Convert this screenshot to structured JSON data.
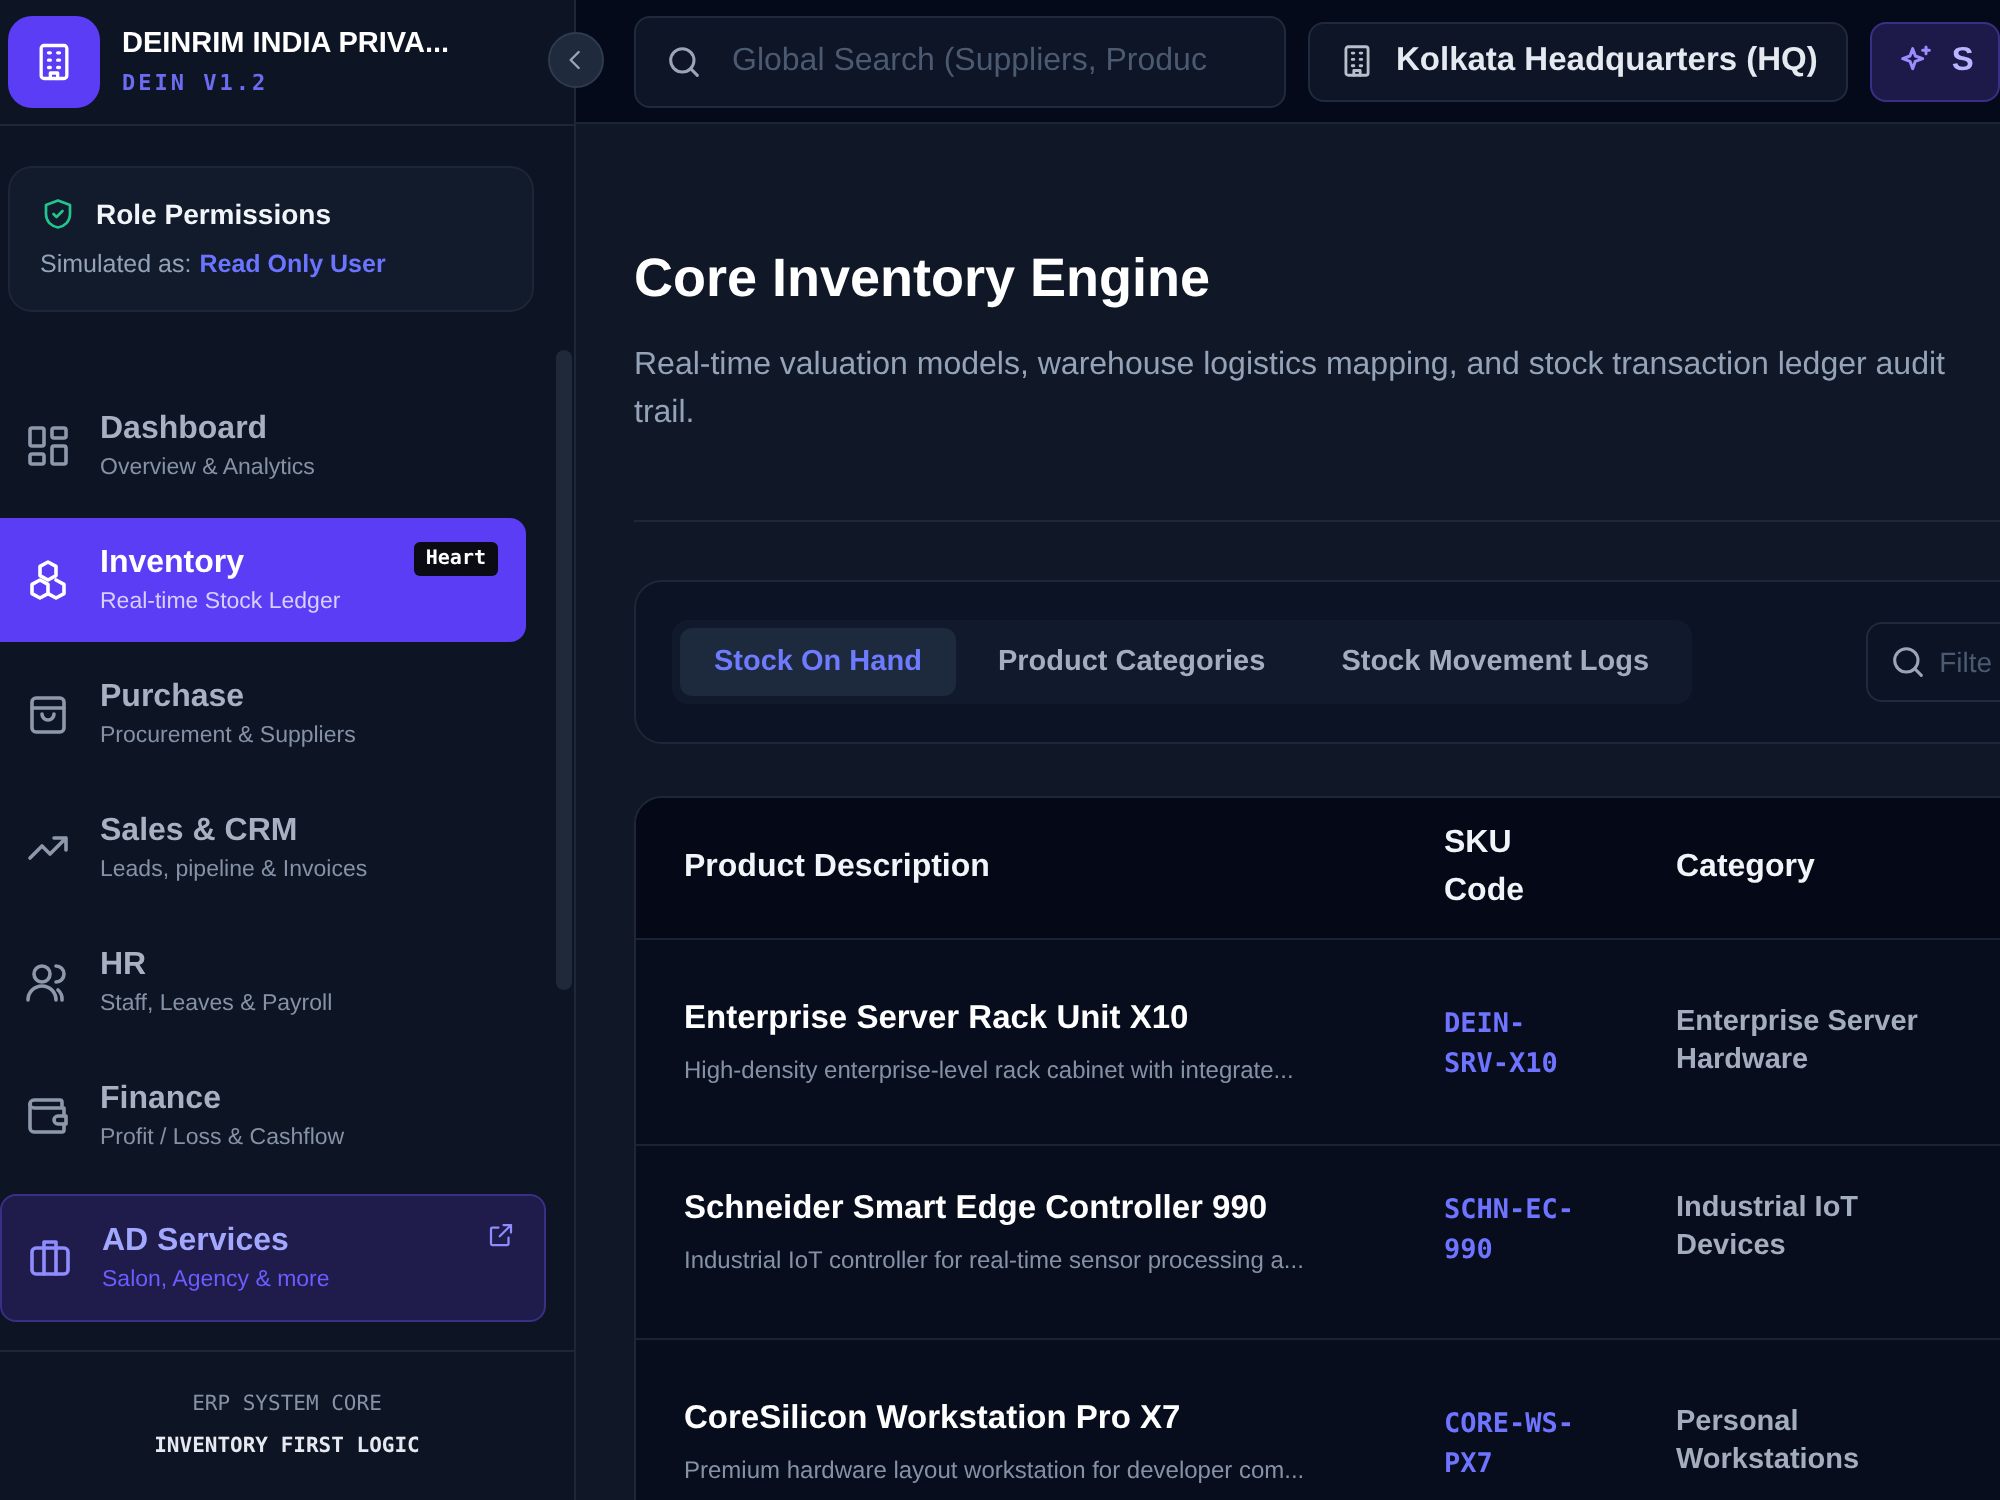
{
  "brand": {
    "name": "DEINRIM INDIA PRIVA...",
    "version": "DEIN V1.2"
  },
  "role_card": {
    "title": "Role Permissions",
    "label": "Simulated as:",
    "role": "Read Only User"
  },
  "nav": [
    {
      "kind": "dashboard",
      "title": "Dashboard",
      "subtitle": "Overview & Analytics",
      "selected": false
    },
    {
      "kind": "inventory",
      "title": "Inventory",
      "subtitle": "Real-time Stock Ledger",
      "selected": true,
      "badge": "Heart"
    },
    {
      "kind": "purchase",
      "title": "Purchase",
      "subtitle": "Procurement & Suppliers",
      "selected": false
    },
    {
      "kind": "sales",
      "title": "Sales & CRM",
      "subtitle": "Leads, pipeline & Invoices",
      "selected": false
    },
    {
      "kind": "hr",
      "title": "HR",
      "subtitle": "Staff, Leaves & Payroll",
      "selected": false
    },
    {
      "kind": "finance",
      "title": "Finance",
      "subtitle": "Profit / Loss & Cashflow",
      "selected": false
    }
  ],
  "external_link": {
    "title": "AD Services",
    "subtitle": "Salon, Agency & more"
  },
  "sidebar_footer": [
    "ERP SYSTEM CORE",
    "INVENTORY FIRST LOGIC"
  ],
  "header": {
    "search": {
      "placeholder": "Global Search (Suppliers, Produc"
    },
    "location": "Kolkata Headquarters (HQ)",
    "action_button": "S"
  },
  "page": {
    "title": "Core Inventory Engine",
    "description": "Real-time valuation models, warehouse logistics mapping, and stock transaction ledger audit trail."
  },
  "tabs": [
    {
      "label": "Stock On Hand",
      "selected": true
    },
    {
      "label": "Product Categories",
      "selected": false
    },
    {
      "label": "Stock Movement Logs",
      "selected": false
    }
  ],
  "filter": {
    "placeholder": "Filte"
  },
  "table": {
    "columns": [
      "Product Description",
      "SKU Code",
      "Category"
    ],
    "rows": [
      {
        "name": "Enterprise Server Rack Unit X10",
        "description": "High-density enterprise-level rack cabinet with integrate...",
        "sku": "DEIN-SRV-X10",
        "category": "Enterprise Server Hardware"
      },
      {
        "name": "Schneider Smart Edge Controller 990",
        "description": "Industrial IoT controller for real-time sensor processing a...",
        "sku": "SCHN-EC-990",
        "category": "Industrial IoT Devices"
      },
      {
        "name": "CoreSilicon Workstation Pro X7",
        "description": "Premium hardware layout workstation for developer com...",
        "sku": "CORE-WS-PX7",
        "category": "Personal Workstations"
      }
    ]
  }
}
